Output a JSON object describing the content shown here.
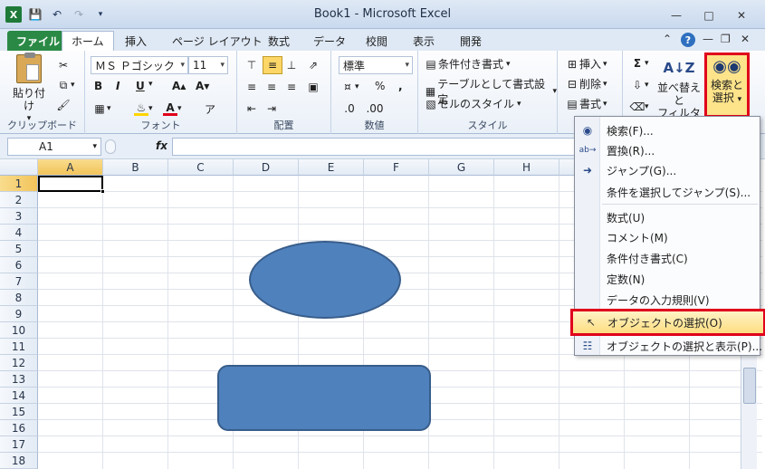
{
  "window": {
    "title": "Book1 - Microsoft Excel"
  },
  "qat": {
    "logo": "X",
    "save_icon": "save-icon",
    "undo_icon": "undo-icon",
    "redo_icon": "redo-icon"
  },
  "tabs": [
    {
      "label": "ファイル"
    },
    {
      "label": "ホーム"
    },
    {
      "label": "挿入"
    },
    {
      "label": "ページ レイアウト"
    },
    {
      "label": "数式"
    },
    {
      "label": "データ"
    },
    {
      "label": "校閲"
    },
    {
      "label": "表示"
    },
    {
      "label": "開発"
    }
  ],
  "ribbon": {
    "clipboard": {
      "label": "クリップボード",
      "paste": "貼り付け"
    },
    "font": {
      "label": "フォント",
      "name": "ＭＳ Ｐゴシック",
      "size": "11"
    },
    "alignment": {
      "label": "配置"
    },
    "number": {
      "label": "数値",
      "format": "標準"
    },
    "styles": {
      "label": "スタイル",
      "conditional": "条件付き書式",
      "table": "テーブルとして書式設定",
      "cell": "セルのスタイル"
    },
    "cells": {
      "insert": "挿入",
      "delete": "削除",
      "format": "書式"
    },
    "editing": {
      "sort_filter_1": "並べ替えと",
      "sort_filter_2": "フィルター",
      "find_select_1": "検索と",
      "find_select_2": "選択"
    }
  },
  "formulabar": {
    "name_box": "A1",
    "fx": "fx"
  },
  "grid": {
    "columns": [
      "A",
      "B",
      "C",
      "D",
      "E",
      "F",
      "G",
      "H",
      "I"
    ],
    "rows": [
      "1",
      "2",
      "3",
      "4",
      "5",
      "6",
      "7",
      "8",
      "9",
      "10",
      "11",
      "12",
      "13",
      "14",
      "15",
      "16",
      "17",
      "18"
    ]
  },
  "menu": {
    "items": [
      {
        "label": "検索(F)...",
        "icon": "binoculars-icon"
      },
      {
        "label": "置換(R)...",
        "icon": "replace-icon"
      },
      {
        "label": "ジャンプ(G)...",
        "icon": "arrow-right-icon"
      },
      {
        "label": "条件を選択してジャンプ(S)...",
        "icon": ""
      },
      {
        "label": "数式(U)",
        "icon": ""
      },
      {
        "label": "コメント(M)",
        "icon": ""
      },
      {
        "label": "条件付き書式(C)",
        "icon": ""
      },
      {
        "label": "定数(N)",
        "icon": ""
      },
      {
        "label": "データの入力規則(V)",
        "icon": ""
      },
      {
        "label": "オブジェクトの選択(O)",
        "icon": "cursor-icon"
      },
      {
        "label": "オブジェクトの選択と表示(P)...",
        "icon": "selection-pane-icon"
      }
    ]
  }
}
